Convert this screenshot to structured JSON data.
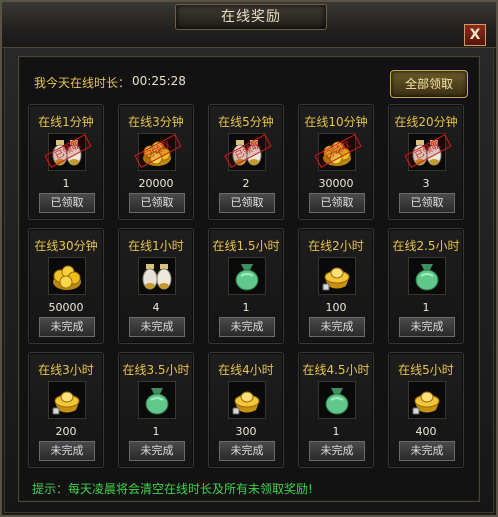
{
  "window": {
    "title": "在线奖励",
    "close_label": "X"
  },
  "header": {
    "online_label": "我今天在线时长：",
    "online_value": "00:25:28",
    "claim_all_label": "全部领取"
  },
  "rewards": [
    {
      "title": "在线1分钟",
      "qty": "1",
      "button": "已领取",
      "icon": "potion-pair-icon",
      "claimed": true,
      "stamp": "已领取"
    },
    {
      "title": "在线3分钟",
      "qty": "20000",
      "button": "已领取",
      "icon": "gold-coins-icon",
      "claimed": true,
      "stamp": "已领取"
    },
    {
      "title": "在线5分钟",
      "qty": "2",
      "button": "已领取",
      "icon": "potion-pair-icon",
      "claimed": true,
      "stamp": "已领取"
    },
    {
      "title": "在线10分钟",
      "qty": "30000",
      "button": "已领取",
      "icon": "gold-coins-icon",
      "claimed": true,
      "stamp": "已领取"
    },
    {
      "title": "在线20分钟",
      "qty": "3",
      "button": "已领取",
      "icon": "potion-pair-icon",
      "claimed": true,
      "stamp": "已领取"
    },
    {
      "title": "在线30分钟",
      "qty": "50000",
      "button": "未完成",
      "icon": "gold-coins-icon",
      "claimed": false
    },
    {
      "title": "在线1小时",
      "qty": "4",
      "button": "未完成",
      "icon": "potion-pair-icon",
      "claimed": false
    },
    {
      "title": "在线1.5小时",
      "qty": "1",
      "button": "未完成",
      "icon": "green-bag-icon",
      "claimed": false
    },
    {
      "title": "在线2小时",
      "qty": "100",
      "button": "未完成",
      "icon": "gold-ingot-icon",
      "claimed": false
    },
    {
      "title": "在线2.5小时",
      "qty": "1",
      "button": "未完成",
      "icon": "green-bag-icon",
      "claimed": false
    },
    {
      "title": "在线3小时",
      "qty": "200",
      "button": "未完成",
      "icon": "gold-ingot-icon",
      "claimed": false
    },
    {
      "title": "在线3.5小时",
      "qty": "1",
      "button": "未完成",
      "icon": "green-bag-icon",
      "claimed": false
    },
    {
      "title": "在线4小时",
      "qty": "300",
      "button": "未完成",
      "icon": "gold-ingot-icon",
      "claimed": false
    },
    {
      "title": "在线4.5小时",
      "qty": "1",
      "button": "未完成",
      "icon": "green-bag-icon",
      "claimed": false
    },
    {
      "title": "在线5小时",
      "qty": "400",
      "button": "未完成",
      "icon": "gold-ingot-icon",
      "claimed": false
    }
  ],
  "footer": {
    "tip": "提示：每天凌晨将会清空在线时长及所有未领取奖励!"
  },
  "colors": {
    "title_gold": "#e7c34a",
    "tip_green": "#3fd24b",
    "stamp_red": "#d21a1a"
  }
}
